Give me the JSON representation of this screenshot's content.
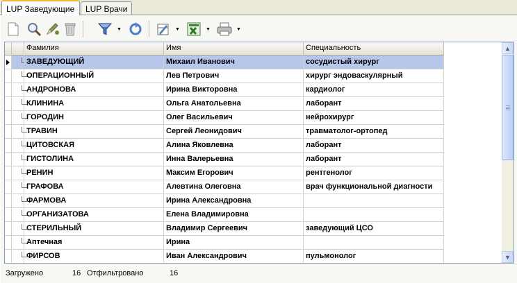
{
  "tabs": [
    {
      "label": "LUP Заведующие",
      "active": true
    },
    {
      "label": "LUP Врачи",
      "active": false
    }
  ],
  "toolbar": {
    "icons": [
      "new-document-icon",
      "search-icon",
      "edit-pencil-icon",
      "trash-icon",
      "filter-icon",
      "refresh-icon",
      "edit-table-icon",
      "excel-export-icon",
      "print-icon"
    ]
  },
  "grid": {
    "columns": [
      "Фамилия",
      "Имя",
      "Специальность"
    ],
    "rows": [
      {
        "last": "ЗАВЕДУЮЩИЙ",
        "first": "Михаил Иванович",
        "spec": "сосудистый хирург",
        "selected": true
      },
      {
        "last": "ОПЕРАЦИОННЫЙ",
        "first": "Лев Петрович",
        "spec": "хирург эндоваскулярный"
      },
      {
        "last": "АНДРОНОВА",
        "first": "Ирина Викторовна",
        "spec": "кардиолог"
      },
      {
        "last": "КЛИНИНА",
        "first": "Ольга Анатольевна",
        "spec": "лаборант"
      },
      {
        "last": "ГОРОДИН",
        "first": "Олег Васильевич",
        "spec": "нейрохирург"
      },
      {
        "last": "ТРАВИН",
        "first": "Сергей Леонидович",
        "spec": "травматолог-ортопед"
      },
      {
        "last": "ЦИТОВСКАЯ",
        "first": "Алина Яковлевна",
        "spec": "лаборант"
      },
      {
        "last": "ГИСТОЛИНА",
        "first": "Инна Валерьевна",
        "spec": "лаборант"
      },
      {
        "last": "РЕНИН",
        "first": "Максим Егорович",
        "spec": "рентгенолог"
      },
      {
        "last": "ГРАФОВА",
        "first": "Алевтина Олеговна",
        "spec": "врач функциональной диагности"
      },
      {
        "last": "ФАРМОВА",
        "first": "Ирина Александровна",
        "spec": ""
      },
      {
        "last": "ОРГАНИЗАТОВА",
        "first": "Елена Владимировна",
        "spec": ""
      },
      {
        "last": "СТЕРИЛЬНЫЙ",
        "first": "Владимир Сергеевич",
        "spec": "заведующий ЦСО"
      },
      {
        "last": "Аптечная",
        "first": "Ирина",
        "spec": ""
      },
      {
        "last": "ФИРСОВ",
        "first": "Иван Александрович",
        "spec": "пульмонолог"
      }
    ]
  },
  "status": {
    "loaded_label": "Загружено",
    "loaded_value": "16",
    "filtered_label": "Отфильтровано",
    "filtered_value": "16"
  }
}
